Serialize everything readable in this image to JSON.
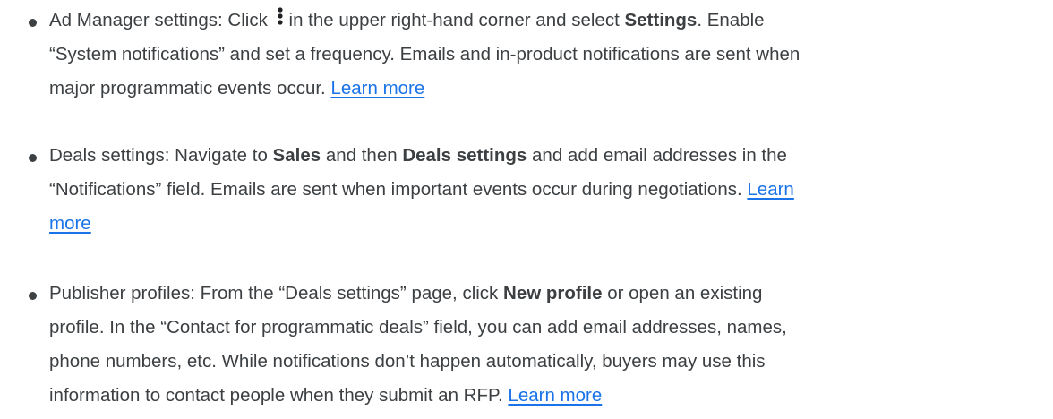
{
  "items": [
    {
      "lines": [
        [
          "Ad Manager settings: Click ",
          "KEBAB",
          "in  the upper right-hand corner and select ",
          "B:Settings",
          ". Enable"
        ],
        [
          "“System notifications” and set a frequency. Emails and in-product notifications are sent when"
        ],
        [
          "major programmatic events occur. ",
          "L:Learn more"
        ]
      ]
    },
    {
      "lines": [
        [
          "Deals settings: Navigate to ",
          "B:Sales",
          " and then ",
          "B:Deals settings",
          " and add email addresses in the"
        ],
        [
          "“Notifications” field. Emails are sent when important events occur during negotiations. ",
          "L:Learn"
        ],
        [
          "L:more"
        ]
      ]
    },
    {
      "lines": [
        [
          "Publisher profiles: From the “Deals settings” page, click ",
          "B:New profile",
          " or open an existing"
        ],
        [
          "profile. In the “Contact for programmatic deals” field, you can add email addresses, names,"
        ],
        [
          "phone numbers, etc. While notifications don’t happen automatically,  buyers may use this"
        ],
        [
          "information to contact people when they submit an RFP. ",
          "L:Learn more"
        ]
      ]
    }
  ],
  "icons": {
    "more_menu": "vertical-dots-icon"
  },
  "colors": {
    "text": "#3c4043",
    "link": "#1a73e8"
  }
}
